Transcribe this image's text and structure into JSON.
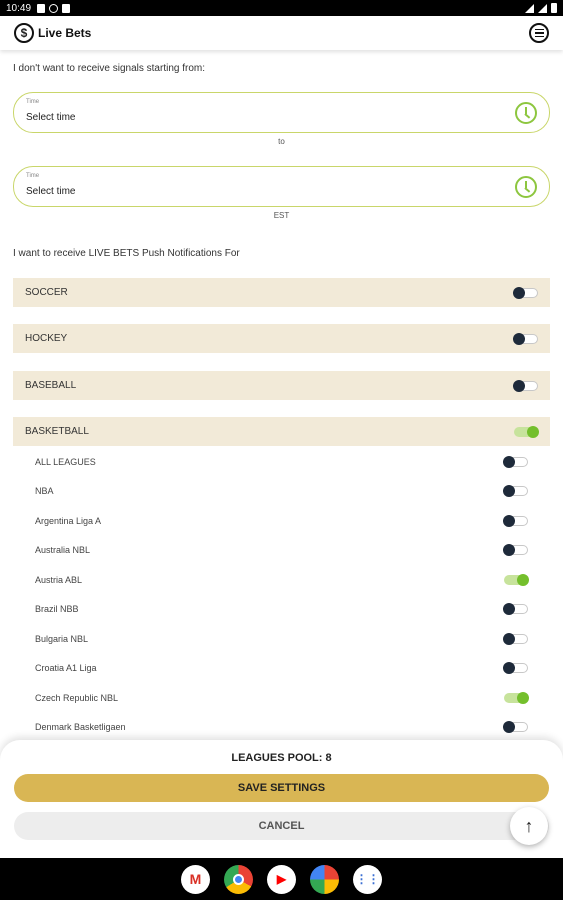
{
  "status_bar": {
    "time": "10:49"
  },
  "app_bar": {
    "title": "Live Bets",
    "logo_glyph": "$"
  },
  "intro_text": "I don't want to receive signals starting from:",
  "time_from": {
    "label": "Time",
    "value": "Select time"
  },
  "separator_to": "to",
  "time_to": {
    "label": "Time",
    "value": "Select time"
  },
  "timezone": "EST",
  "push_heading": "I want to receive LIVE BETS Push Notifications For",
  "sports": [
    {
      "name": "SOCCER",
      "enabled": false
    },
    {
      "name": "HOCKEY",
      "enabled": false
    },
    {
      "name": "BASEBALL",
      "enabled": false
    },
    {
      "name": "BASKETBALL",
      "enabled": true
    }
  ],
  "leagues": [
    {
      "name": "ALL LEAGUES",
      "enabled": false
    },
    {
      "name": "NBA",
      "enabled": false
    },
    {
      "name": "Argentina Liga A",
      "enabled": false
    },
    {
      "name": "Australia NBL",
      "enabled": false
    },
    {
      "name": "Austria ABL",
      "enabled": true
    },
    {
      "name": "Brazil NBB",
      "enabled": false
    },
    {
      "name": "Bulgaria NBL",
      "enabled": false
    },
    {
      "name": "Croatia A1 Liga",
      "enabled": false
    },
    {
      "name": "Czech Republic NBL",
      "enabled": true
    },
    {
      "name": "Denmark Basketligaen",
      "enabled": false
    }
  ],
  "footer": {
    "pool_label": "LEAGUES POOL: 8",
    "save_label": "SAVE SETTINGS",
    "cancel_label": "CANCEL"
  },
  "colors": {
    "accent_gold": "#d9b654",
    "toggle_on": "#74bf2c",
    "toggle_off_knob": "#1e2a3a",
    "row_bg": "#f2ead8",
    "field_border": "#c9d66a"
  },
  "dock_apps": [
    "gmail-icon",
    "chrome-icon",
    "youtube-icon",
    "photos-icon",
    "app-drawer-icon"
  ]
}
